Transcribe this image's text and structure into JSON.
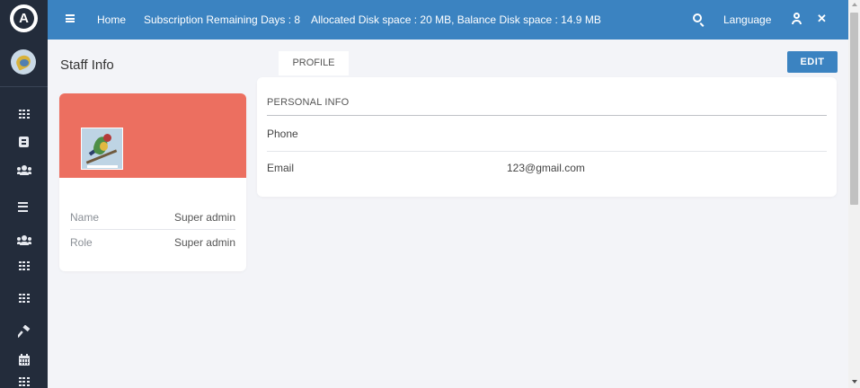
{
  "topbar": {
    "home_label": "Home",
    "subscription_text": "Subscription Remaining Days : 8",
    "disk_text": "Allocated Disk space : 20 MB, Balance Disk space : 14.9 MB",
    "language_label": "Language",
    "background_color": "#3b83c1"
  },
  "sidebar": {
    "logo_letter": "A",
    "icons": [
      "grid-icon",
      "card-icon",
      "users-icon",
      "list-icon",
      "users-icon",
      "grid-icon",
      "grid-icon",
      "hammer-icon",
      "calendar-icon",
      "grid-icon"
    ],
    "background_color": "#232c3b"
  },
  "page": {
    "title": "Staff Info",
    "tab_profile": "PROFILE",
    "edit_label": "EDIT"
  },
  "profile_card": {
    "banner_color": "#ec6f60",
    "rows": [
      {
        "label": "Name",
        "value": "Super admin"
      },
      {
        "label": "Role",
        "value": "Super admin"
      }
    ]
  },
  "personal_info": {
    "heading": "PERSONAL INFO",
    "fields": [
      {
        "label": "Phone",
        "value": ""
      },
      {
        "label": "Email",
        "value": "123@gmail.com"
      }
    ]
  }
}
